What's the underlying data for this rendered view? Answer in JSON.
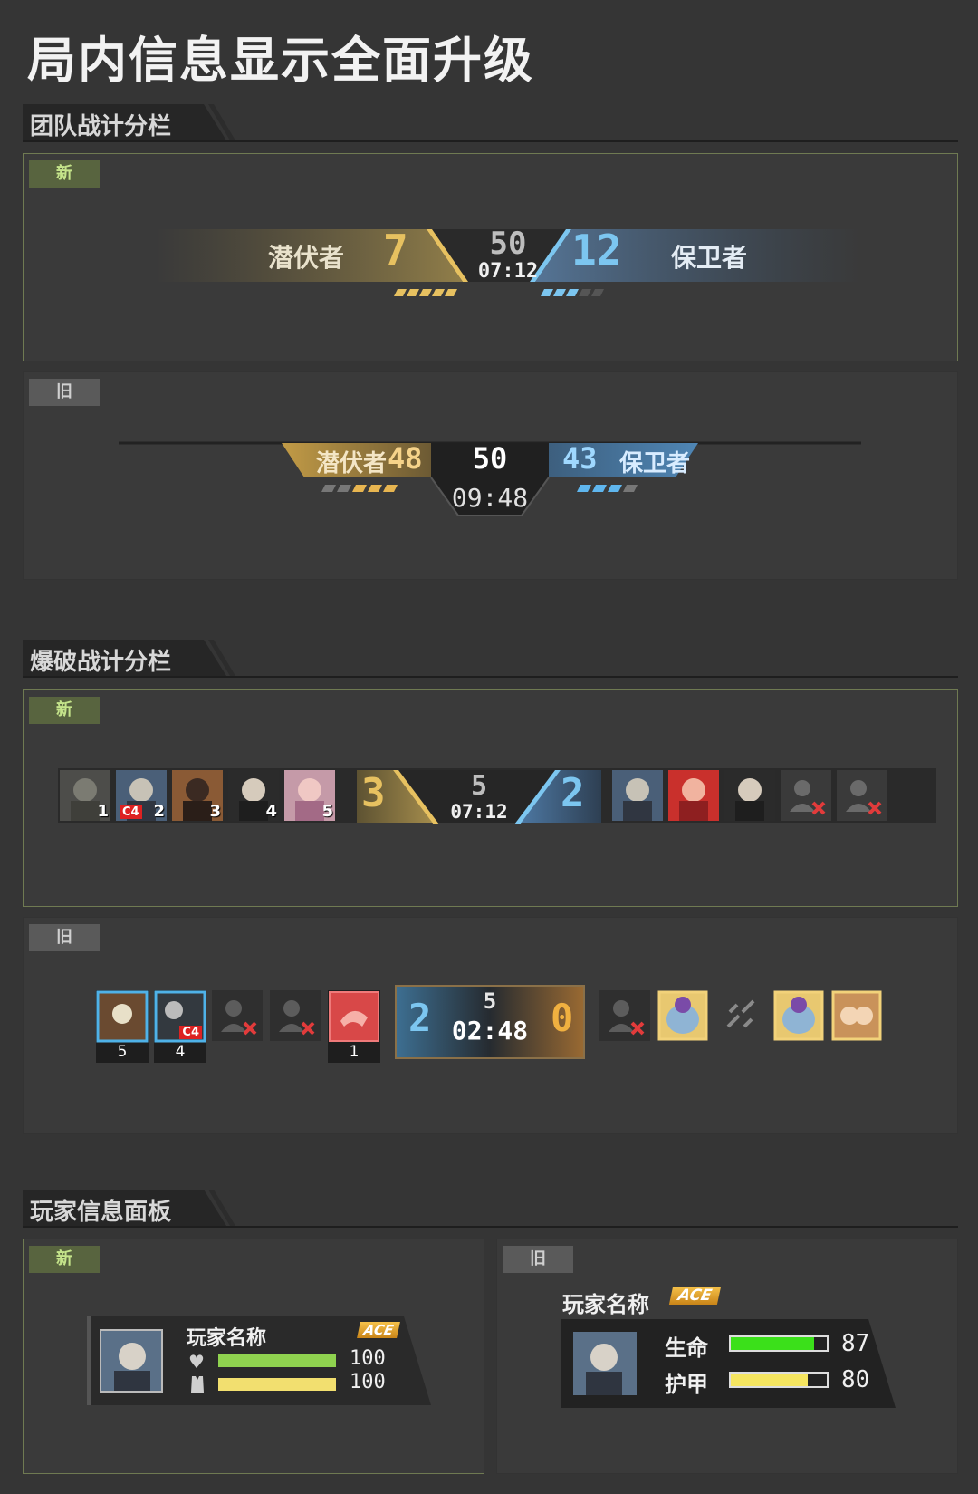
{
  "title": "局内信息显示全面升级",
  "sections": {
    "team": {
      "label": "团队战计分栏"
    },
    "bomb": {
      "label": "爆破战计分栏"
    },
    "player": {
      "label": "玩家信息面板"
    }
  },
  "tags": {
    "new": "新",
    "old": "旧"
  },
  "team_new": {
    "left_team": "潜伏者",
    "left_score": "7",
    "target": "50",
    "time": "07:12",
    "right_score": "12",
    "right_team": "保卫者",
    "left_color": "#e7c160",
    "right_color": "#7cc6f0"
  },
  "team_old": {
    "left_team": "潜伏者",
    "left_score": "48",
    "target": "50",
    "time": "09:48",
    "right_score": "43",
    "right_team": "保卫者"
  },
  "bomb_new": {
    "left_players": [
      {
        "num": "1",
        "c4": ""
      },
      {
        "num": "2",
        "c4": "C4"
      },
      {
        "num": "3",
        "c4": ""
      },
      {
        "num": "4",
        "c4": ""
      },
      {
        "num": "5",
        "c4": ""
      }
    ],
    "left_score": "3",
    "target": "5",
    "time": "07:12",
    "right_score": "2"
  },
  "bomb_old": {
    "left_players": [
      {
        "num": "5",
        "c4": ""
      },
      {
        "num": "4",
        "c4": "C4"
      },
      {
        "num": "",
        "c4": ""
      },
      {
        "num": "",
        "c4": ""
      },
      {
        "num": "1",
        "c4": ""
      }
    ],
    "left_score": "2",
    "target": "5",
    "time": "02:48",
    "right_score": "0"
  },
  "player_new": {
    "name": "玩家名称",
    "badge": "ACE",
    "health": "100",
    "armor": "100",
    "health_fraction": 1.0,
    "armor_fraction": 1.0,
    "health_color": "#8fd24f",
    "armor_color": "#f2df6f"
  },
  "player_old": {
    "name": "玩家名称",
    "badge": "ACE",
    "health_label": "生命",
    "armor_label": "护甲",
    "health": "87",
    "armor": "80",
    "health_fraction": 0.87,
    "armor_fraction": 0.8,
    "health_color": "#3be01a",
    "armor_color": "#f5e560"
  }
}
